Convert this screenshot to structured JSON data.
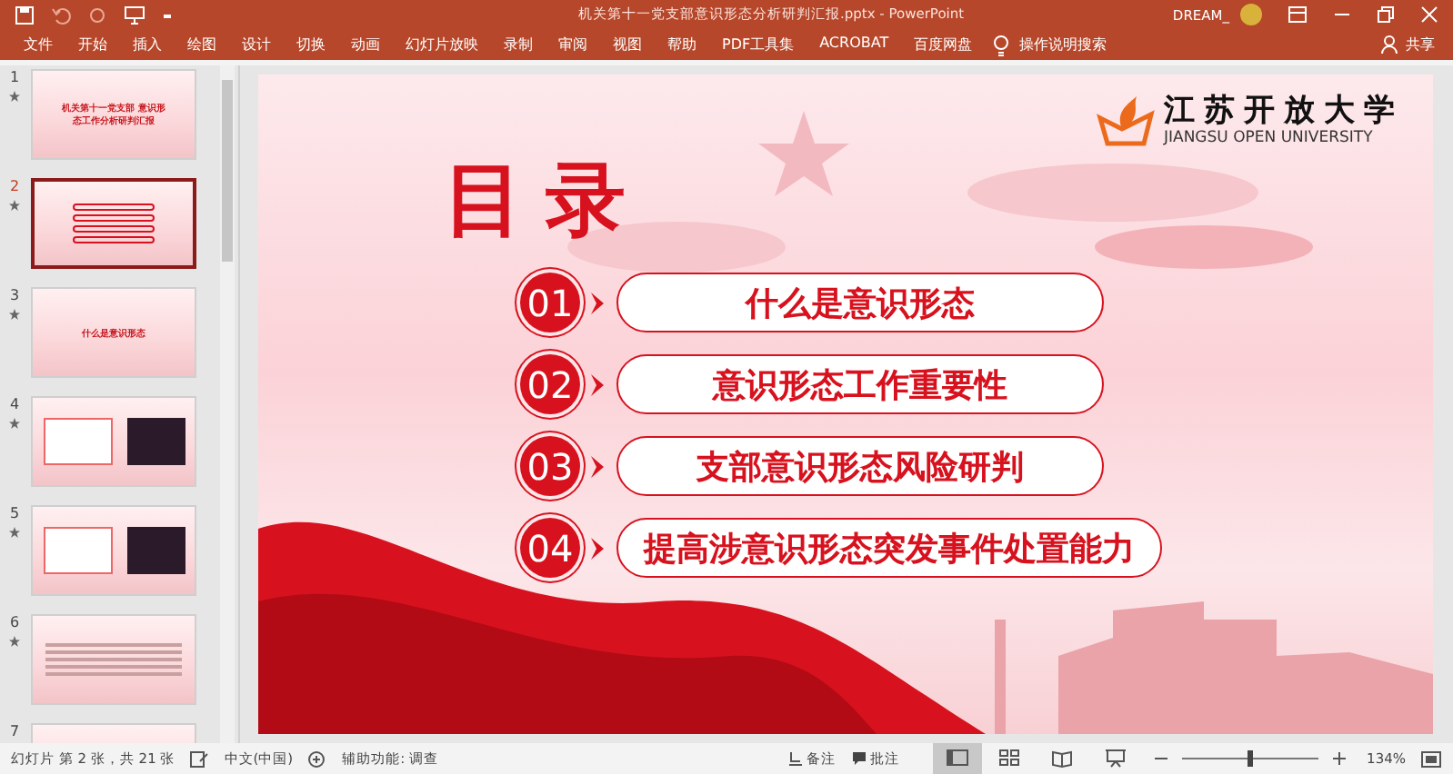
{
  "window": {
    "title": "机关第十一党支部意识形态分析研判汇报.pptx  -  PowerPoint",
    "user": "DREAM_"
  },
  "ribbon": {
    "tabs": [
      {
        "label": "文件",
        "selected": false
      },
      {
        "label": "开始",
        "selected": false
      },
      {
        "label": "插入",
        "selected": false
      },
      {
        "label": "绘图",
        "selected": false
      },
      {
        "label": "设计",
        "selected": false
      },
      {
        "label": "切换",
        "selected": false
      },
      {
        "label": "动画",
        "selected": false
      },
      {
        "label": "幻灯片放映",
        "selected": false
      },
      {
        "label": "录制",
        "selected": false
      },
      {
        "label": "审阅",
        "selected": false
      },
      {
        "label": "视图",
        "selected": false
      },
      {
        "label": "帮助",
        "selected": false
      },
      {
        "label": "PDF工具集",
        "selected": false
      },
      {
        "label": "ACROBAT",
        "selected": false
      },
      {
        "label": "百度网盘",
        "selected": false
      }
    ],
    "search": "操作说明搜索",
    "share": "共享"
  },
  "thumbnails": [
    {
      "number": "1",
      "kind": "title",
      "title": "机关第十一党支部 意识形态工作分析研判汇报",
      "selected": false
    },
    {
      "number": "2",
      "kind": "contents",
      "selected": true
    },
    {
      "number": "3",
      "kind": "section",
      "title": "什么是意识形态",
      "selected": false
    },
    {
      "number": "4",
      "kind": "photo",
      "selected": false
    },
    {
      "number": "5",
      "kind": "photo",
      "selected": false
    },
    {
      "number": "6",
      "kind": "text",
      "selected": false
    },
    {
      "number": "7",
      "kind": "partial",
      "selected": false
    }
  ],
  "slide": {
    "heading": "目录",
    "logo": {
      "name": "江苏开放大学",
      "english": "JIANGSU OPEN UNIVERSITY"
    },
    "items": [
      {
        "number": "01",
        "text": "什么是意识形态"
      },
      {
        "number": "02",
        "text": "意识形态工作重要性"
      },
      {
        "number": "03",
        "text": "支部意识形态风险研判"
      },
      {
        "number": "04",
        "text": "提高涉意识形态突发事件处置能力"
      }
    ]
  },
  "status_bar": {
    "slide_count": "幻灯片 第 2 张，共 21 张",
    "language": "中文(中国)",
    "accessibility": "辅助功能: 调查",
    "notes": "备注",
    "comments": "批注",
    "views": [
      {
        "kind": "normal",
        "selected": true
      },
      {
        "kind": "sorter",
        "selected": false
      },
      {
        "kind": "reading",
        "selected": false
      },
      {
        "kind": "show",
        "selected": false
      }
    ],
    "zoom": {
      "level": 0.5,
      "reading": "134%"
    }
  }
}
